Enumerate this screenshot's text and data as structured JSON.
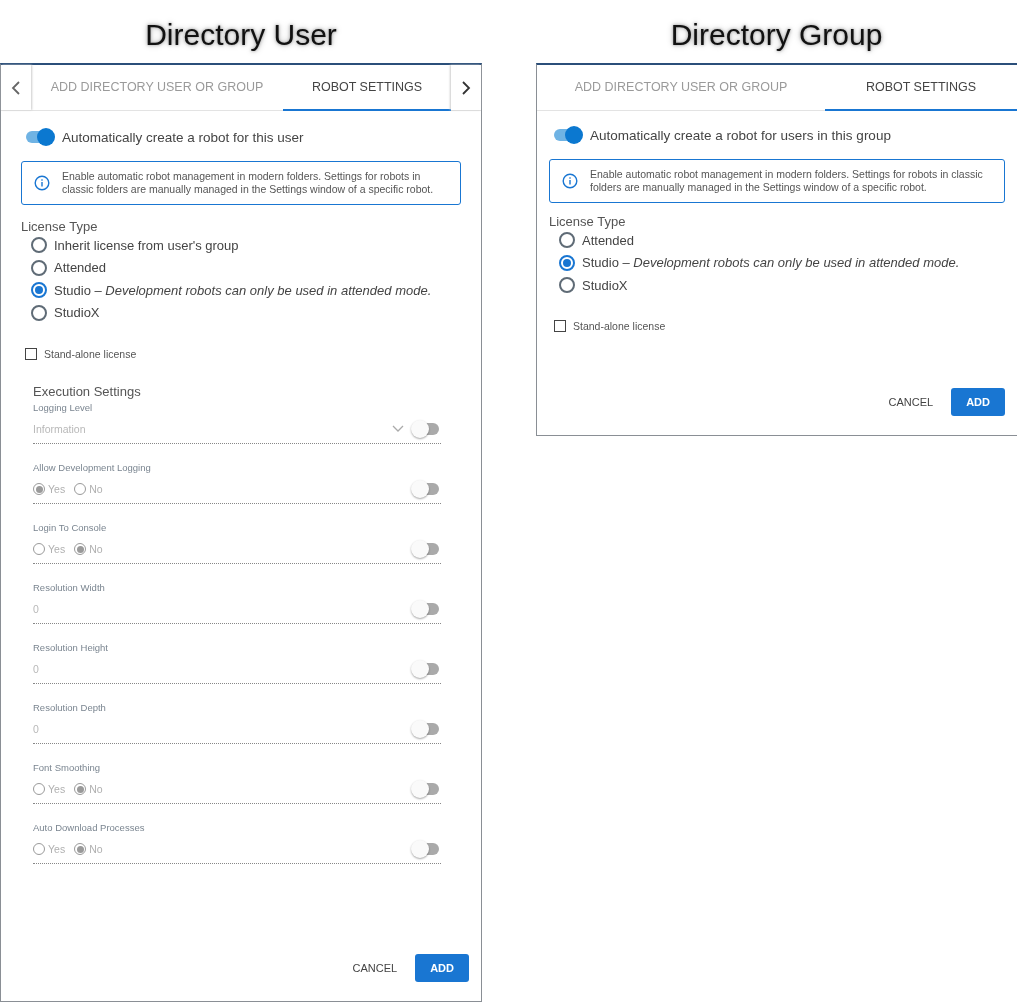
{
  "panels": [
    {
      "heading": "Directory User",
      "tab_scroll_buttons": true,
      "tabs": [
        {
          "label": "ADD DIRECTORY USER OR GROUP",
          "selected": false
        },
        {
          "label": "ROBOT SETTINGS",
          "selected": true
        }
      ],
      "auto_create": {
        "label": "Automatically create a robot for this user",
        "on": true
      },
      "info": "Enable automatic robot management in modern folders. Settings for robots in classic folders are manually managed in the Settings window of a specific robot.",
      "license": {
        "label": "License Type",
        "options": [
          {
            "label": "Inherit license from user's group",
            "selected": false
          },
          {
            "label": "Attended",
            "selected": false
          },
          {
            "label": "Studio – *Development robots can only be used in attended mode.*",
            "selected": true
          },
          {
            "label": "StudioX",
            "selected": false
          }
        ]
      },
      "standalone": {
        "label": "Stand-alone license",
        "checked": false
      },
      "execution": {
        "title": "Execution Settings",
        "fields": [
          {
            "kind": "dropdown",
            "label": "Logging Level",
            "value": "Information",
            "override": false
          },
          {
            "kind": "radio",
            "label": "Allow Development Logging",
            "override": false,
            "options": [
              {
                "label": "Yes",
                "selected": true
              },
              {
                "label": "No",
                "selected": false
              }
            ]
          },
          {
            "kind": "radio",
            "label": "Login To Console",
            "override": false,
            "options": [
              {
                "label": "Yes",
                "selected": false
              },
              {
                "label": "No",
                "selected": true
              }
            ]
          },
          {
            "kind": "number",
            "label": "Resolution Width",
            "value": "0",
            "override": false
          },
          {
            "kind": "number",
            "label": "Resolution Height",
            "value": "0",
            "override": false
          },
          {
            "kind": "number",
            "label": "Resolution Depth",
            "value": "0",
            "override": false
          },
          {
            "kind": "radio",
            "label": "Font Smoothing",
            "override": false,
            "options": [
              {
                "label": "Yes",
                "selected": false
              },
              {
                "label": "No",
                "selected": true
              }
            ]
          },
          {
            "kind": "radio",
            "label": "Auto Download Processes",
            "override": false,
            "options": [
              {
                "label": "Yes",
                "selected": false
              },
              {
                "label": "No",
                "selected": true
              }
            ]
          }
        ]
      },
      "buttons": [
        {
          "label": "CANCEL",
          "kind": "text"
        },
        {
          "label": "ADD",
          "kind": "primary"
        }
      ]
    },
    {
      "heading": "Directory Group",
      "tab_scroll_buttons": false,
      "tabs": [
        {
          "label": "ADD DIRECTORY USER OR GROUP",
          "selected": false
        },
        {
          "label": "ROBOT SETTINGS",
          "selected": true
        }
      ],
      "auto_create": {
        "label": "Automatically create a robot for users in this group",
        "on": true
      },
      "info": "Enable automatic robot management in modern folders. Settings for robots in classic folders are manually managed in the Settings window of a specific robot.",
      "license": {
        "label": "License Type",
        "options": [
          {
            "label": "Attended",
            "selected": false
          },
          {
            "label": "Studio – *Development robots can only be used in attended mode.*",
            "selected": true
          },
          {
            "label": "StudioX",
            "selected": false
          }
        ]
      },
      "standalone": {
        "label": "Stand-alone license",
        "checked": false
      },
      "buttons": [
        {
          "label": "CANCEL",
          "kind": "text"
        },
        {
          "label": "ADD",
          "kind": "primary"
        }
      ]
    }
  ]
}
